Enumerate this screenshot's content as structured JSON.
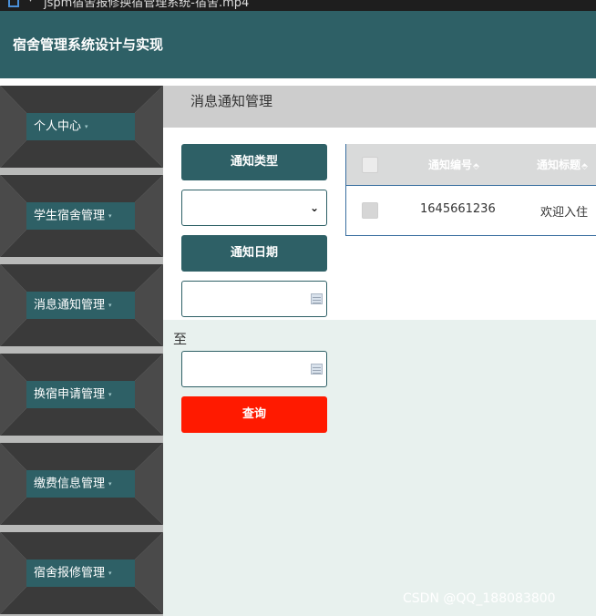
{
  "titlebar": {
    "text": "jspm宿舍报修换宿管理系统-宿舍.mp4",
    "arrow": "▾"
  },
  "app": {
    "title": "宿舍管理系统设计与实现"
  },
  "sidebar": {
    "caret": "▾",
    "items": [
      {
        "label": "个人中心"
      },
      {
        "label": "学生宿舍管理"
      },
      {
        "label": "消息通知管理"
      },
      {
        "label": "换宿申请管理"
      },
      {
        "label": "缴费信息管理"
      },
      {
        "label": "宿舍报修管理"
      }
    ]
  },
  "page": {
    "title": "消息通知管理"
  },
  "filters": {
    "type_button": "通知类型",
    "type_select_value": "",
    "date_button": "通知日期",
    "date_from_value": "",
    "to_label": "至",
    "date_to_value": "",
    "search_button": "查询"
  },
  "table": {
    "sort_icon": "⬘",
    "headers": [
      "通知编号",
      "通知标题"
    ],
    "rows": [
      {
        "id": "1645661236",
        "title": "欢迎入住"
      }
    ]
  },
  "watermark": "CSDN @QQ_188083800",
  "colors": {
    "teal": "#2e6066",
    "red": "#ff1a00",
    "sidebar_bg": "#b9bab9"
  }
}
